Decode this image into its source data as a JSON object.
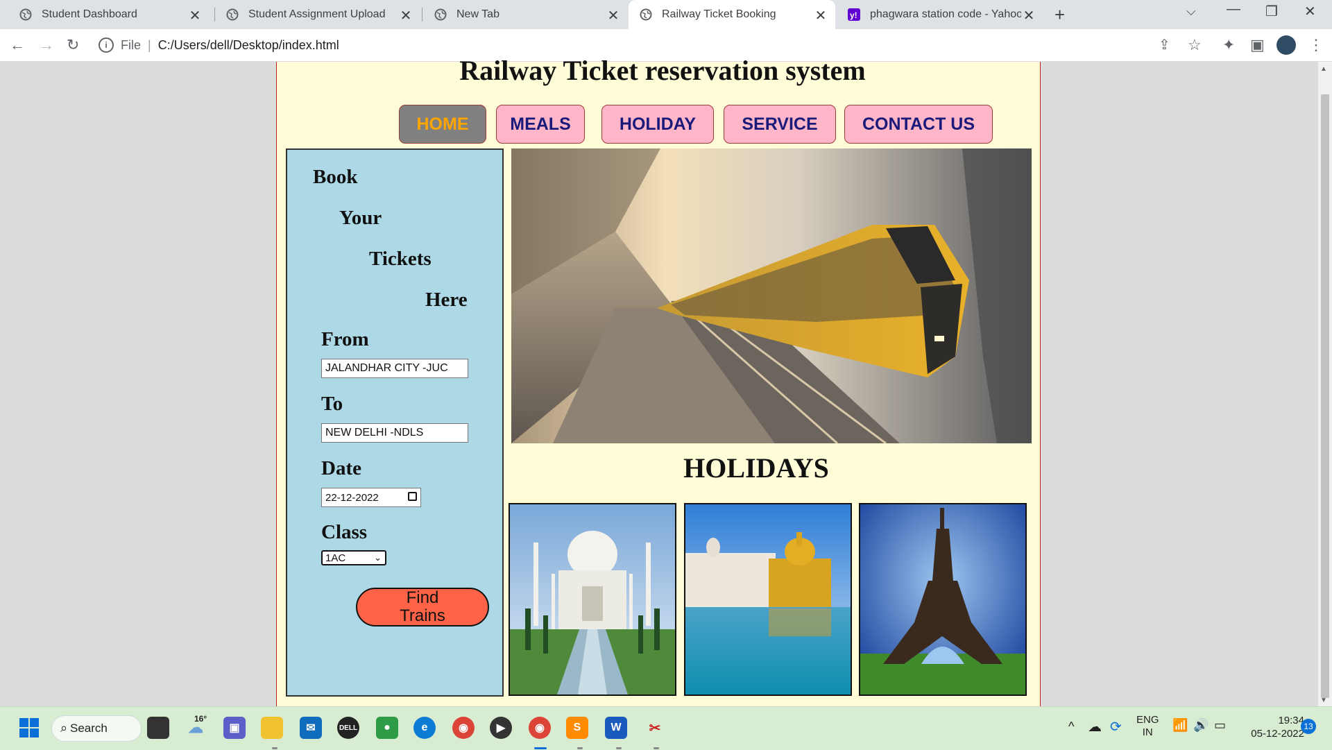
{
  "browser": {
    "tabs": [
      {
        "title": "Student Dashboard",
        "active": false
      },
      {
        "title": "Student Assignment Upload",
        "active": false
      },
      {
        "title": "New Tab",
        "active": false
      },
      {
        "title": "Railway Ticket Booking",
        "active": true
      },
      {
        "title": "phagwara station code - Yahoo In",
        "active": false
      }
    ],
    "address": {
      "scheme_label": "File",
      "url": "C:/Users/dell/Desktop/index.html"
    }
  },
  "site": {
    "title": "Railway Ticket reservation system",
    "nav": [
      "HOME",
      "MEALS",
      "HOLIDAY",
      "SERVICE",
      "CONTACT US"
    ],
    "active_nav": "HOME"
  },
  "booking": {
    "slogan": [
      "Book",
      "Your",
      "Tickets",
      "Here"
    ],
    "from_label": "From",
    "from_value": "JALANDHAR CITY -JUC",
    "to_label": "To",
    "to_value": "NEW DELHI -NDLS",
    "date_label": "Date",
    "date_value": "22-12-2022",
    "class_label": "Class",
    "class_value": "1AC",
    "find_button": "Find Trains"
  },
  "holidays": {
    "title": "HOLIDAYS"
  },
  "taskbar": {
    "search_label": "Search",
    "weather_temp": "16°",
    "lang_line1": "ENG",
    "lang_line2": "IN",
    "time": "19:34",
    "date": "05-12-2022",
    "notification_count": "13"
  },
  "colors": {
    "page_bg": "#fffdd8",
    "panel_bg": "#add8e6",
    "nav_bg": "#ffb6c8",
    "nav_active_bg": "#808080",
    "nav_active_text": "#ffa500",
    "find_button_bg": "#ff6347"
  }
}
